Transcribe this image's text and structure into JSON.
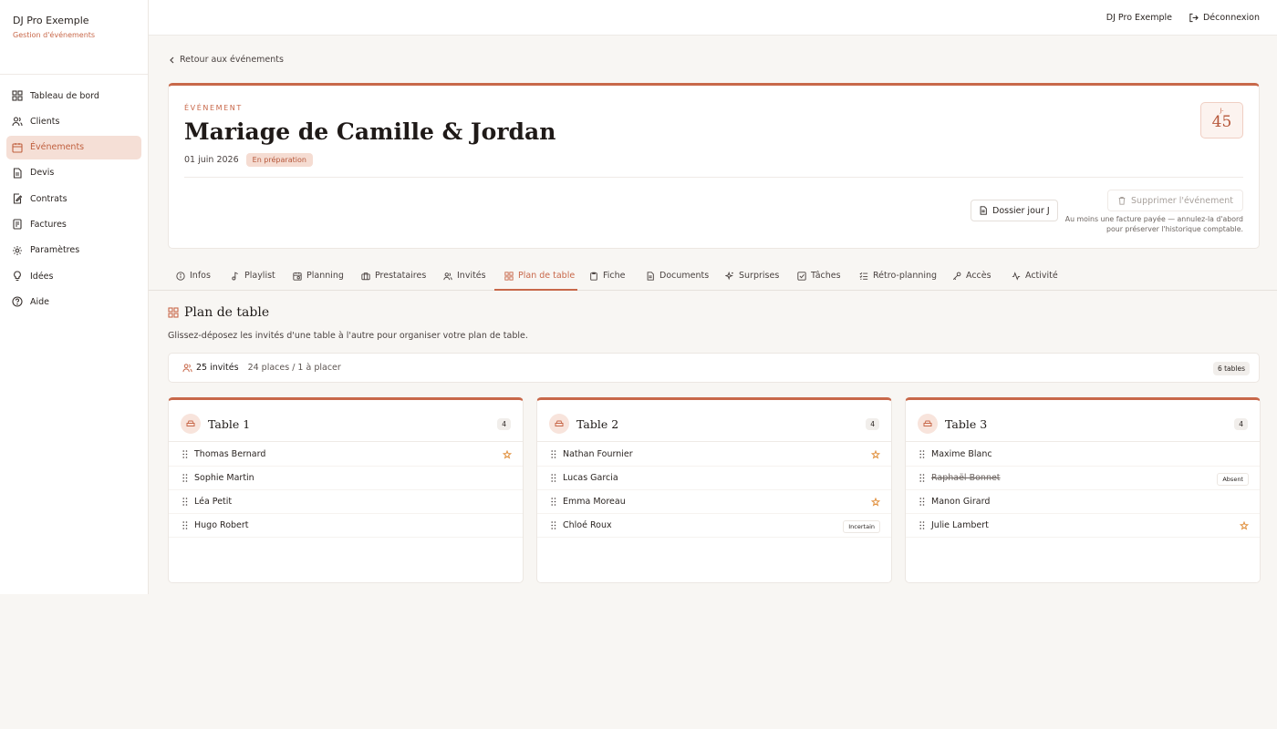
{
  "brand": {
    "name": "DJ Pro Exemple",
    "subtitle": "Gestion d'événements"
  },
  "sidebar": {
    "items": [
      {
        "label": "Tableau de bord",
        "icon": "dashboard-icon"
      },
      {
        "label": "Clients",
        "icon": "users-icon"
      },
      {
        "label": "Événements",
        "icon": "calendar-icon",
        "active": true
      },
      {
        "label": "Devis",
        "icon": "document-icon"
      },
      {
        "label": "Contrats",
        "icon": "contract-icon"
      },
      {
        "label": "Factures",
        "icon": "invoice-icon"
      },
      {
        "label": "Paramètres",
        "icon": "gear-icon"
      },
      {
        "label": "Idées",
        "icon": "lightbulb-icon"
      },
      {
        "label": "Aide",
        "icon": "help-icon"
      }
    ]
  },
  "topbar": {
    "user": "DJ Pro Exemple",
    "logout": "Déconnexion"
  },
  "back_label": "Retour aux événements",
  "event": {
    "eyebrow": "ÉVÉNEMENT",
    "title": "Mariage de Camille & Jordan",
    "date": "01 juin 2026",
    "status": "En préparation",
    "countdown_label": "J-",
    "countdown_value": "45",
    "dossier_button": "Dossier jour J",
    "delete_button": "Supprimer l'événement",
    "delete_note": "Au moins une facture payée — annulez-la d'abord pour préserver l'historique comptable."
  },
  "tabs": [
    {
      "label": "Infos",
      "icon": "info-icon"
    },
    {
      "label": "Playlist",
      "icon": "music-note-icon"
    },
    {
      "label": "Planning",
      "icon": "calendar-clock-icon"
    },
    {
      "label": "Prestataires",
      "icon": "briefcase-icon"
    },
    {
      "label": "Invités",
      "icon": "guests-icon"
    },
    {
      "label": "Plan de table",
      "icon": "grid-icon",
      "active": true
    },
    {
      "label": "Fiche",
      "icon": "clipboard-icon"
    },
    {
      "label": "Documents",
      "icon": "file-icon"
    },
    {
      "label": "Surprises",
      "icon": "sparkles-icon"
    },
    {
      "label": "Tâches",
      "icon": "checkbox-icon"
    },
    {
      "label": "Rétro-planning",
      "icon": "checklist-icon"
    },
    {
      "label": "Accès",
      "icon": "key-icon"
    },
    {
      "label": "Activité",
      "icon": "activity-icon"
    }
  ],
  "section": {
    "title": "Plan de table",
    "description": "Glissez-déposez les invités d'une table à l'autre pour organiser votre plan de table."
  },
  "stats": {
    "guests": "25 invités",
    "places": "24 places / 1 à placer",
    "tables": "6 tables"
  },
  "tables": [
    {
      "name": "Table 1",
      "count": "4",
      "guests": [
        {
          "name": "Thomas Bernard",
          "star": true
        },
        {
          "name": "Sophie Martin"
        },
        {
          "name": "Léa Petit"
        },
        {
          "name": "Hugo Robert"
        }
      ]
    },
    {
      "name": "Table 2",
      "count": "4",
      "guests": [
        {
          "name": "Nathan Fournier",
          "star": true
        },
        {
          "name": "Lucas Garcia"
        },
        {
          "name": "Emma Moreau",
          "star": true
        },
        {
          "name": "Chloé Roux",
          "tag": "Incertain"
        }
      ]
    },
    {
      "name": "Table 3",
      "count": "4",
      "guests": [
        {
          "name": "Maxime Blanc"
        },
        {
          "name": "Raphaël Bonnet",
          "tag": "Absent",
          "strike": true
        },
        {
          "name": "Manon Girard"
        },
        {
          "name": "Julie Lambert",
          "star": true
        }
      ]
    }
  ]
}
